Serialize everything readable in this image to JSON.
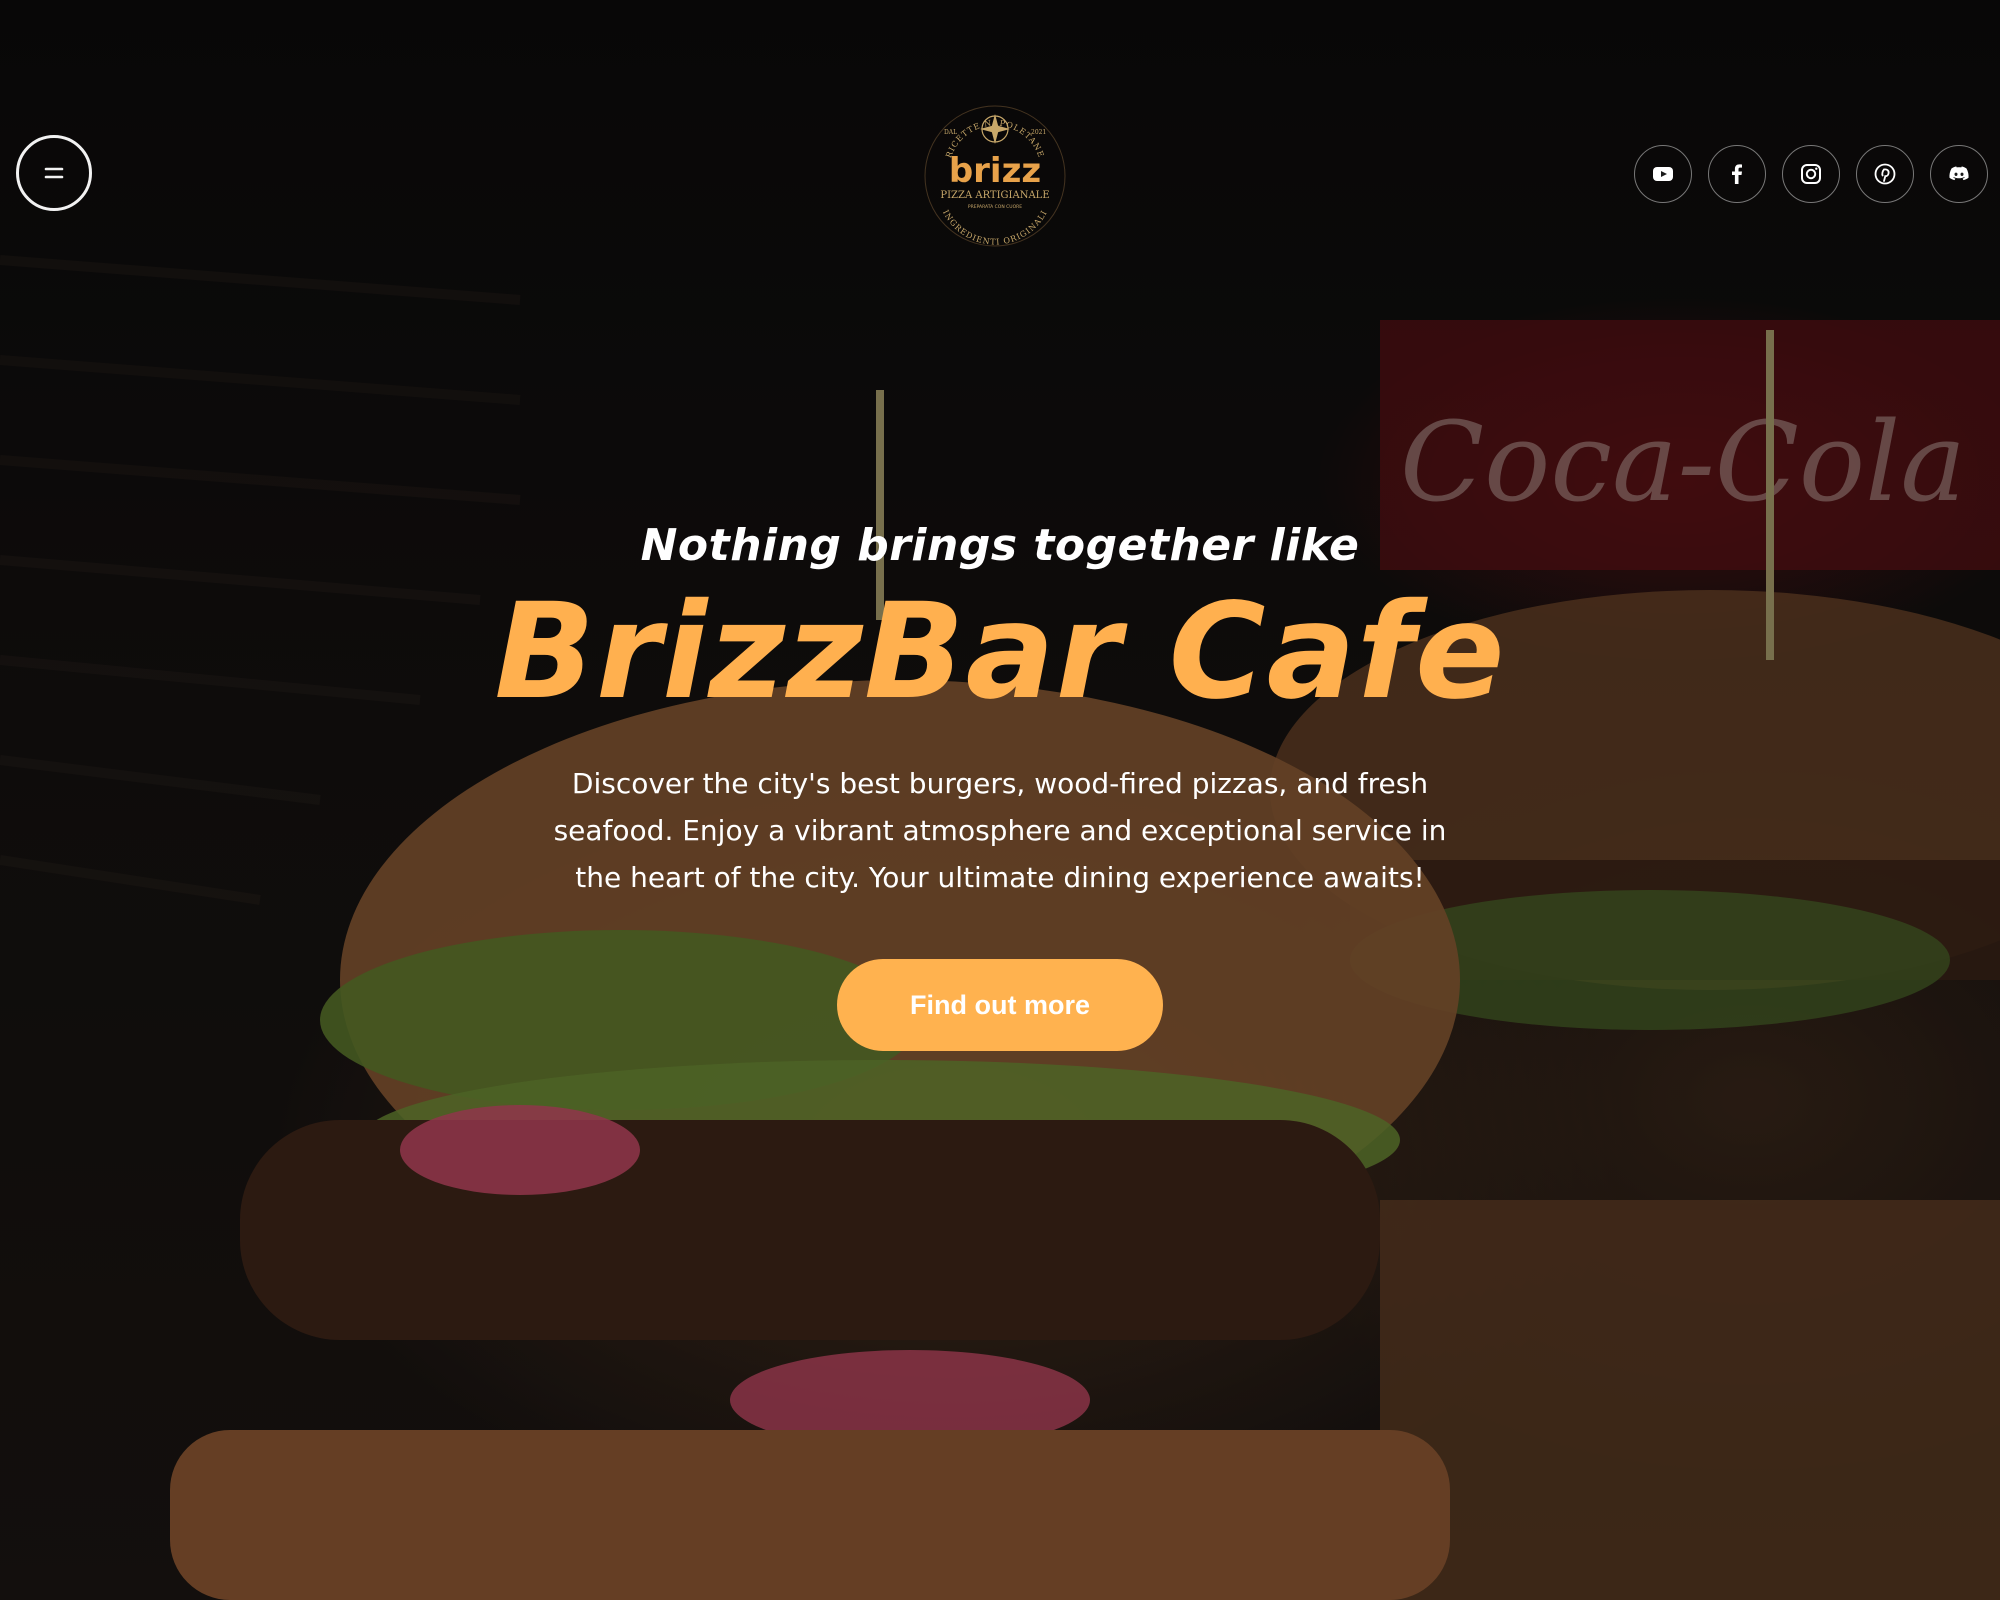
{
  "nav": {
    "menu_icon": "menu-icon",
    "logo": {
      "wordmark": "brizz",
      "subtitle": "PIZZA ARTIGIANALE",
      "top_arc": "RICETTE NAPOLETANE",
      "bottom_arc": "INGREDIENTI ORIGINALI",
      "left_text": "DAL",
      "right_text": "2021",
      "small_text": "PREPARATA CON CUORE"
    },
    "socials": [
      {
        "icon": "youtube-icon"
      },
      {
        "icon": "facebook-icon"
      },
      {
        "icon": "instagram-icon"
      },
      {
        "icon": "pinterest-icon"
      },
      {
        "icon": "discord-icon"
      }
    ]
  },
  "hero": {
    "tagline": "Nothing brings together like",
    "title": "BrizzBar Cafe",
    "description": "Discover the city's best burgers, wood-fired pizzas, and fresh seafood. Enjoy a vibrant atmosphere and exceptional service in the heart of the city. Your ultimate dining experience awaits!",
    "cta_label": "Find out more"
  },
  "background": {
    "overlay_color": "#000000",
    "label": "Coca-Cola"
  },
  "colors": {
    "accent": "#ffb04f",
    "text": "#ffffff"
  }
}
